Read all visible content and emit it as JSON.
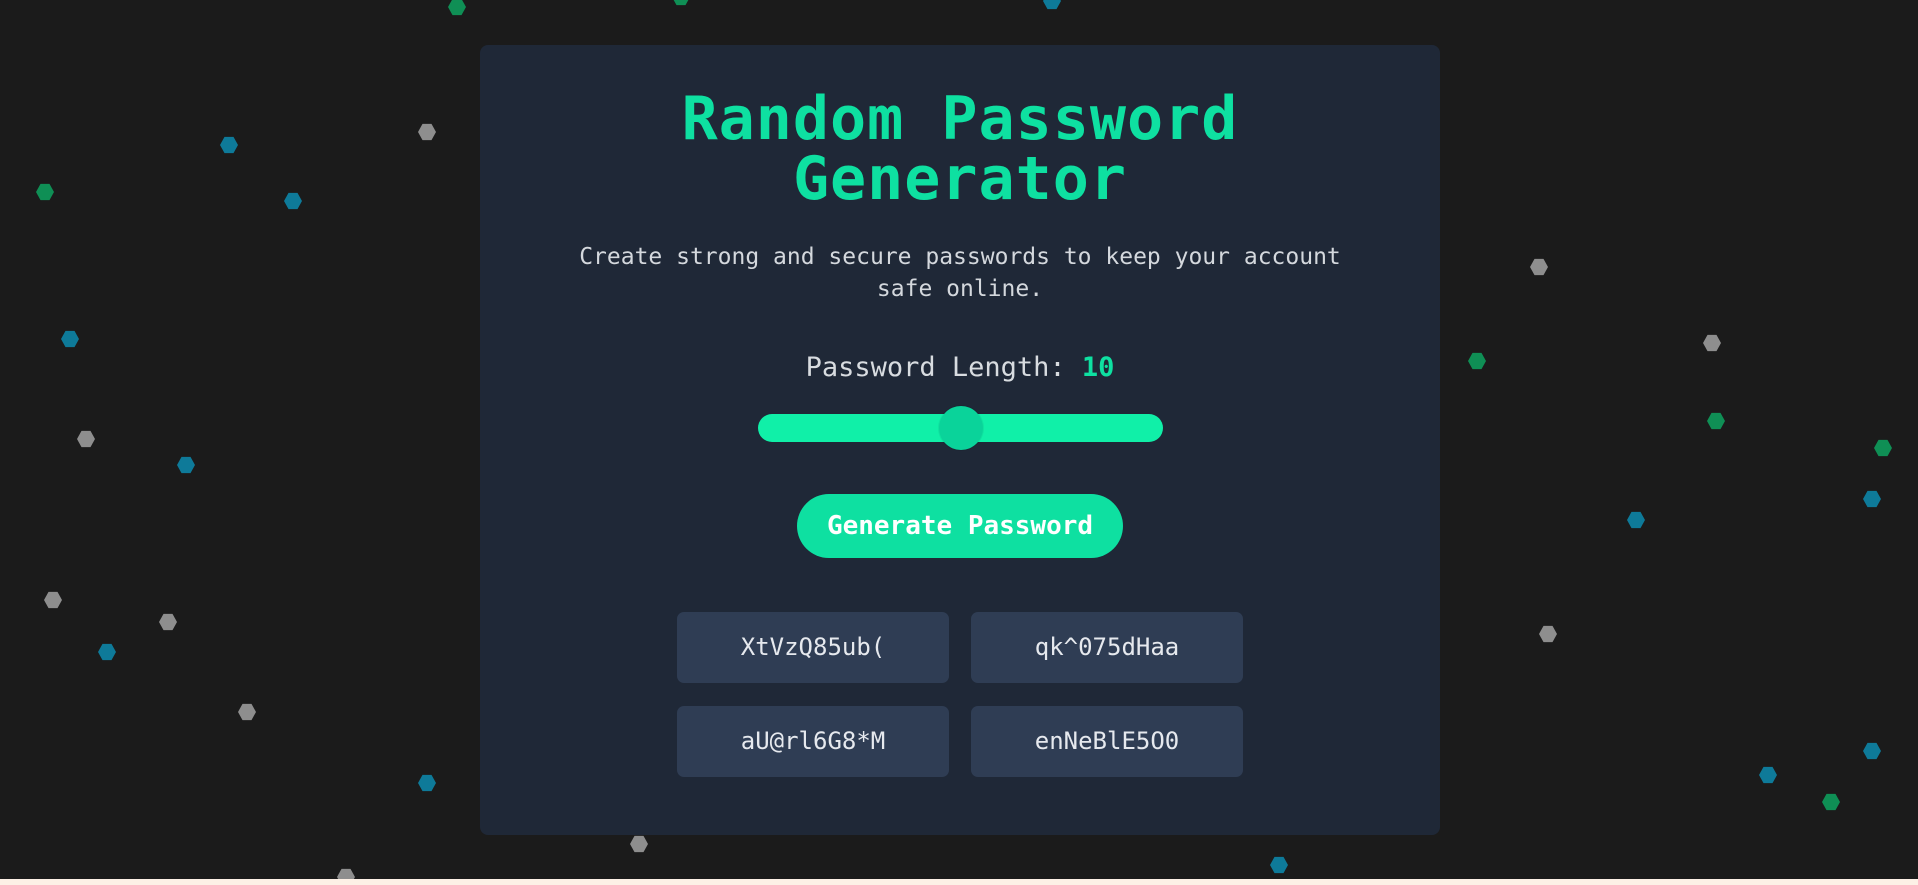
{
  "app": {
    "title": "Random Password Generator",
    "subtitle": "Create strong and secure passwords to keep your account safe online."
  },
  "length": {
    "label": "Password Length: ",
    "value": "10",
    "slider_fraction": 0.5
  },
  "generate_button": {
    "label": "Generate Password"
  },
  "passwords": [
    "XtVzQ85ub(",
    "qk^075dHaa",
    "aU@rl6G8*M",
    "enNeBlE5O0"
  ],
  "colors": {
    "accent": "#0ee0a1",
    "card_bg": "#1f2837",
    "page_bg": "#1b1b1b",
    "password_bg": "#2f3d54",
    "hex_green": "#0f8f55",
    "hex_teal": "#0e7a99",
    "hex_gray": "#8e8e8e"
  }
}
